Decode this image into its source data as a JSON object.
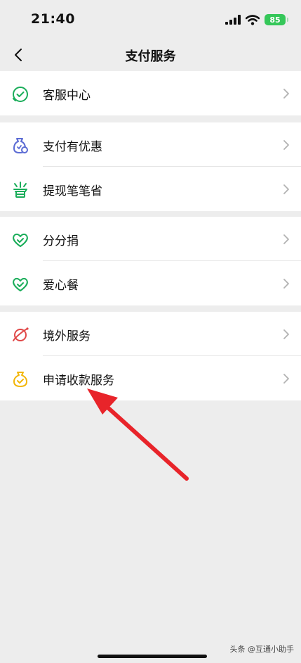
{
  "status_bar": {
    "time": "21:40",
    "battery": "85"
  },
  "header": {
    "title": "支付服务"
  },
  "groups": [
    {
      "items": [
        {
          "label": "客服中心",
          "icon": "headset-chat-icon"
        }
      ]
    },
    {
      "items": [
        {
          "label": "支付有优惠",
          "icon": "discount-bag-icon"
        },
        {
          "label": "提现笔笔省",
          "icon": "save-money-icon"
        }
      ]
    },
    {
      "items": [
        {
          "label": "分分捐",
          "icon": "heart-check-icon"
        },
        {
          "label": "爱心餐",
          "icon": "heart-check-icon"
        }
      ]
    },
    {
      "items": [
        {
          "label": "境外服务",
          "icon": "globe-plane-icon"
        },
        {
          "label": "申请收款服务",
          "icon": "money-bag-icon"
        }
      ]
    }
  ],
  "watermark": "头条 @互通小助手",
  "colors": {
    "green": "#1aad5a",
    "purple": "#5b6bd4",
    "red": "#e04848",
    "yellow": "#f2b60a",
    "arrow": "#e8242a"
  }
}
